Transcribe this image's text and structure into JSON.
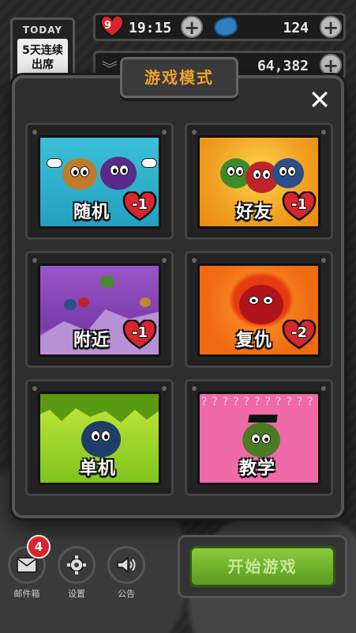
{
  "hud": {
    "today_label": "TODAY",
    "today_text": "5天连续出席",
    "lives": "9",
    "time": "19:15",
    "gems": "124",
    "coins": "64,382",
    "plus_symbol": "+"
  },
  "modal": {
    "title": "游戏模式",
    "close": "✕",
    "modes": [
      {
        "label": "随机",
        "cost": "-1"
      },
      {
        "label": "好友",
        "cost": "-1"
      },
      {
        "label": "附近",
        "cost": "-1"
      },
      {
        "label": "复仇",
        "cost": "-2"
      },
      {
        "label": "单机"
      },
      {
        "label": "教学"
      }
    ]
  },
  "bottom": {
    "mail_badge": "4",
    "mail_label": "邮件箱",
    "settings_label": "设置",
    "notice_label": "公告",
    "start_label": "开始游戏"
  },
  "colors": {
    "accent": "#f0a030",
    "start_green": "#6fb02e",
    "heart_red": "#d7262e"
  }
}
